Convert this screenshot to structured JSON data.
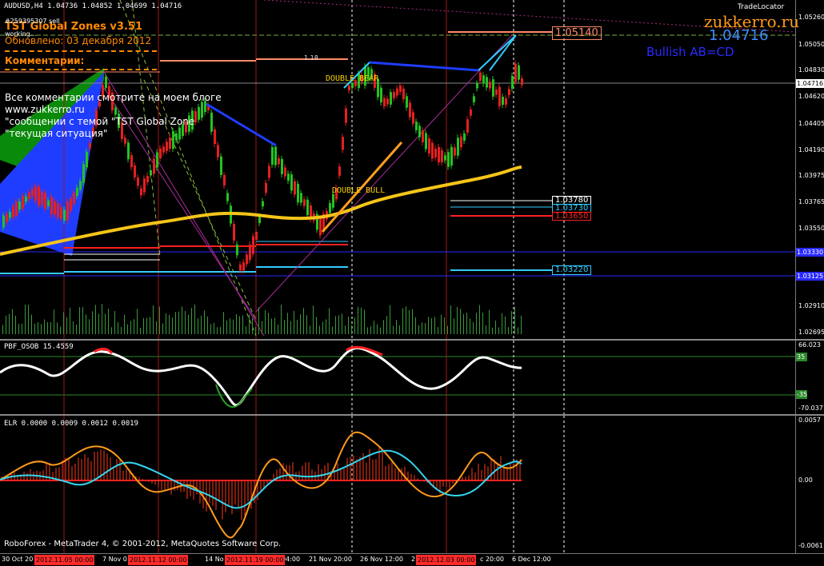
{
  "window": {
    "symbol_line": "AUDUSD,H4  1.04736 1.04852 1.04699 1.04716",
    "trade_locator": "TradeLocator",
    "footer": "RoboForex - MetaTrader 4, © 2001-2012, MetaQuotes Software Corp."
  },
  "overlay": {
    "indicator_title": "TST Global Zones  v3.51",
    "small1": "#259395307 sell",
    "small2": "working...",
    "updated": "Обновлено:   03 декабря 2012",
    "comments_title": "Комментарии:",
    "comment1": "Все комментарии смотрите на моем блоге",
    "comment2": "www.zukkerro.ru",
    "comment3": "\"сообщении с темой \"TST Global Zone",
    "comment4": "\"текущая ситуация\"",
    "site": "zukkerro.ru",
    "current_price": "1.04716",
    "pattern": "Bullish AB=CD",
    "fib_label": "1.18",
    "double_bear": "DOUBLE BEAR",
    "double_bull": "DOUBLE BULL"
  },
  "levels": {
    "top": "1.05140",
    "l1": "1.03780",
    "l2": "1.03730",
    "l3": "1.03650",
    "l4": "1.03220"
  },
  "price_axis": [
    "1.05260",
    "1.05050",
    "1.04830",
    "1.04716",
    "1.04620",
    "1.04405",
    "1.04190",
    "1.03975",
    "1.03765",
    "1.03550",
    "1.03340",
    "1.03125",
    "1.02910",
    "1.02695"
  ],
  "price_boxes": {
    "current": "1.04716",
    "blue1": "1.03330",
    "blue2": "1.03125"
  },
  "osc": {
    "label": "PBF_OSOB 15.4559",
    "max": "66.023",
    "min": "-70.0371",
    "upper": "35",
    "lower": "-35"
  },
  "elr": {
    "label": "ELR 0.0000 0.0009 0.0012 0.0019",
    "max": "0.0057",
    "mid": "0.00",
    "min": "-0.0061"
  },
  "time_axis": {
    "labels": [
      "30 Oct 20",
      "7 Nov 0",
      "14 No",
      "04:00",
      "21 Nov 20:00",
      "26 Nov 12:00",
      "2",
      "c 20:00",
      "6 Dec 12:00"
    ],
    "boxes": [
      "2012.11.05 00:00",
      "2012.11.12 00:00",
      "2012.11.19 00:00",
      "2012.12.03 00:00"
    ]
  },
  "colors": {
    "ma": "#f5c518",
    "bear_line": "#1e3cff",
    "bull_line": "#ffa020",
    "cyan": "#33ccff",
    "red_line": "#ff2020",
    "orange_text": "#ff8a00",
    "site_color": "#ff9a1a",
    "price_color": "#3d8cff",
    "pattern_color": "#2a2aff"
  }
}
